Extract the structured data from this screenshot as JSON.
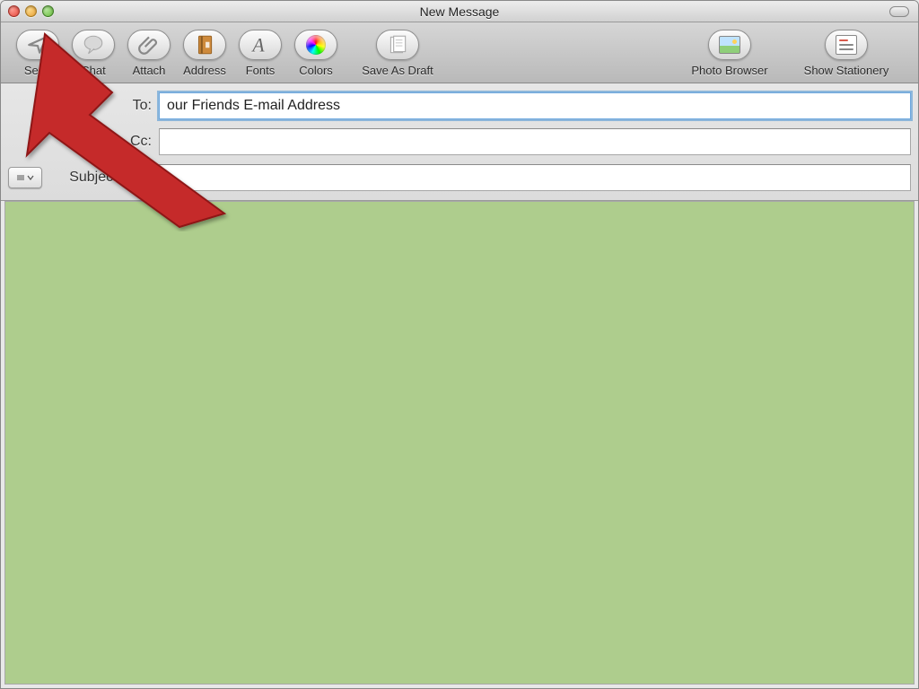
{
  "window": {
    "title": "New Message"
  },
  "toolbar": {
    "send": "Send",
    "chat": "Chat",
    "attach": "Attach",
    "address": "Address",
    "fonts": "Fonts",
    "colors": "Colors",
    "save_as_draft": "Save As Draft",
    "photo_browser": "Photo Browser",
    "show_stationery": "Show Stationery"
  },
  "fields": {
    "to_label": "To:",
    "to_value": "our Friends E-mail Address",
    "cc_label": "Cc:",
    "cc_value": "",
    "subject_label": "Subject:",
    "subject_value": ""
  },
  "body": {
    "background": "#aecd8d"
  },
  "annotation": {
    "arrow_color": "#c52a2a",
    "points_to": "send-button"
  }
}
